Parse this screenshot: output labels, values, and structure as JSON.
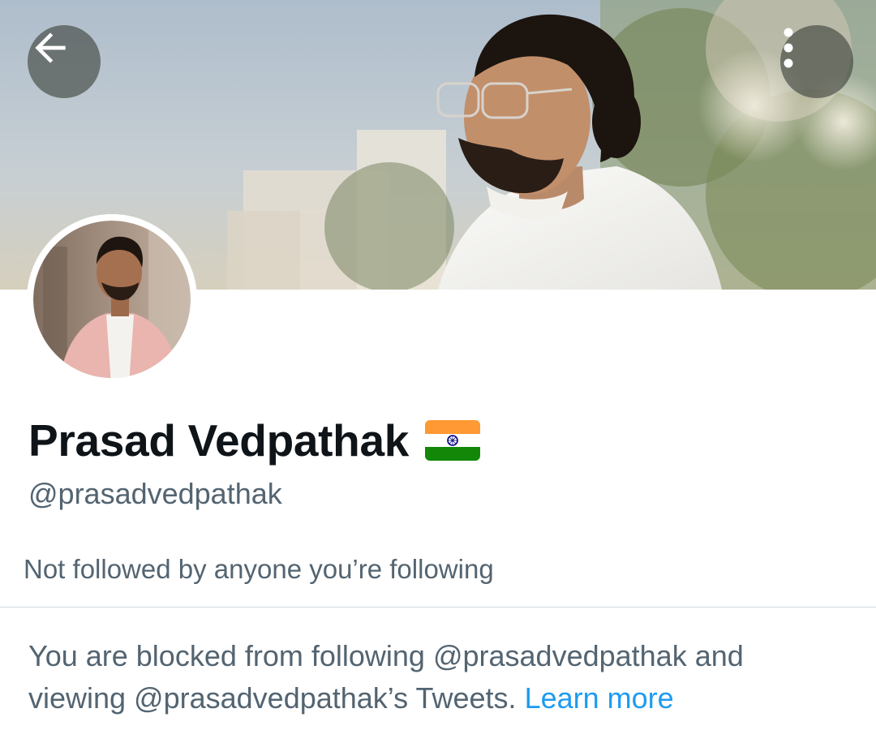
{
  "header": {
    "back_icon": "arrow-left-icon",
    "more_icon": "more-vertical-icon"
  },
  "banner": {
    "image": "banner-photo"
  },
  "profile": {
    "avatar": "profile-photo",
    "display_name": "Prasad Vedpathak",
    "name_emoji": "india-flag-icon",
    "handle": "@prasadvedpathak",
    "followers_note": "Not followed by anyone you’re following"
  },
  "blocked_notice": {
    "message_line1": "You are blocked from following @prasadvedpathak and",
    "message_line2": "viewing @prasadvedpathak’s Tweets.",
    "link_label": "Learn more"
  },
  "colors": {
    "primary_text": "#0f1419",
    "secondary_text": "#536471",
    "link": "#1d9bf0",
    "divider": "#cfd9de",
    "flag_saffron": "#ff9933",
    "flag_green": "#138808",
    "flag_chakra": "#000080"
  }
}
